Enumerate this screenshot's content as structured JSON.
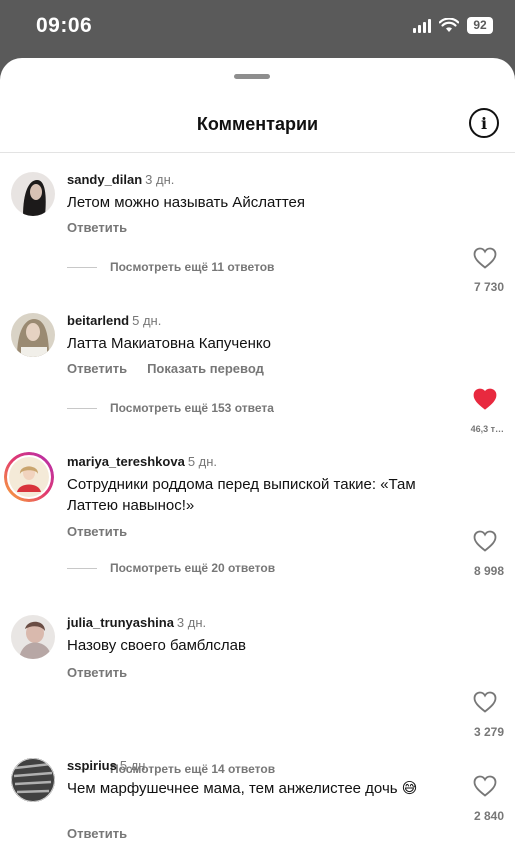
{
  "status_bar": {
    "time": "09:06",
    "battery": "92"
  },
  "sheet": {
    "title": "Комментарии"
  },
  "comments": [
    {
      "username": "sandy_dilan",
      "ago": "3 дн.",
      "text": "Летом можно называть Айслаттея",
      "reply_label": "Ответить",
      "translate_label": "",
      "likes": "7 730",
      "liked": false,
      "view_replies": "Посмотреть ещё 11 ответов"
    },
    {
      "username": "beitarlend",
      "ago": "5 дн.",
      "text": "Латта Макиатовна Капученко",
      "reply_label": "Ответить",
      "translate_label": "Показать перевод",
      "likes": "46,3 т…",
      "liked": true,
      "view_replies": "Посмотреть ещё 153 ответа"
    },
    {
      "username": "mariya_tereshkova",
      "ago": "5 дн.",
      "text": "Сотрудники роддома перед выпиской такие: «Там Латтею навынос!»",
      "reply_label": "Ответить",
      "translate_label": "",
      "likes": "8 998",
      "liked": false,
      "view_replies": "Посмотреть ещё 20 ответов"
    },
    {
      "username": "julia_trunyashina",
      "ago": "3 дн.",
      "text": "Назову своего бамблслав",
      "reply_label": "Ответить",
      "translate_label": "",
      "likes": "3 279",
      "liked": false,
      "view_replies": "Посмотреть ещё 14 ответов"
    },
    {
      "username": "sspirius",
      "ago": "5 дн.",
      "text": "Чем марфушечнее мама, тем анжелистее дочь 😅",
      "reply_label": "Ответить",
      "translate_label": "",
      "likes": "2 840",
      "liked": false,
      "view_replies": ""
    }
  ]
}
